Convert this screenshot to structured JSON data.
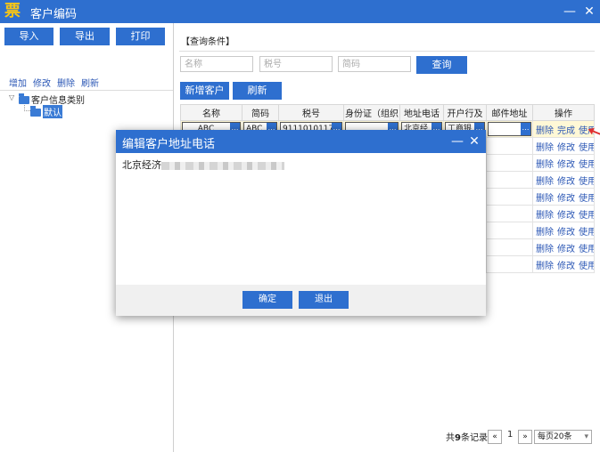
{
  "app": {
    "title": "客户编码",
    "logo_char": "票"
  },
  "window_controls": {
    "minimize": "—",
    "close": "✕"
  },
  "toolbar": {
    "import_label": "导入",
    "export_label": "导出",
    "print_label": "打印"
  },
  "category_actions": {
    "add": "增加",
    "edit": "修改",
    "delete": "删除",
    "refresh": "刷新"
  },
  "tree": {
    "root_label": "客户信息类别",
    "child_label": "默认"
  },
  "query": {
    "header": "【查询条件】",
    "name_placeholder": "名称",
    "taxno_placeholder": "税号",
    "code_placeholder": "简码",
    "search_label": "查询"
  },
  "list_actions": {
    "new_customer": "新增客户",
    "refresh": "刷新"
  },
  "table": {
    "columns": [
      "名称",
      "简码",
      "税号",
      "身份证（组织",
      "地址电话",
      "开户行及",
      "邮件地址",
      "操作"
    ],
    "edit_row": {
      "name": "ABC",
      "code": "ABC",
      "taxno": "9111010117",
      "idcard": "",
      "address": "北京经",
      "bank": "工商银",
      "email": "",
      "ops": [
        "删除",
        "完成",
        "使用"
      ]
    },
    "row_ops": [
      "删除",
      "修改",
      "使用"
    ],
    "row_count": 9
  },
  "pagination": {
    "total_prefix": "共",
    "total_count": "9",
    "total_suffix": "条记录",
    "prev": "«",
    "page": "1",
    "next": "»",
    "per_page": "每页20条"
  },
  "dialog": {
    "title": "编辑客户地址电话",
    "content_prefix": "北京经济",
    "confirm_label": "确定",
    "exit_label": "退出"
  },
  "colors": {
    "accent": "#2e6fcf",
    "link": "#2b57b5",
    "logo": "#f5c518"
  }
}
